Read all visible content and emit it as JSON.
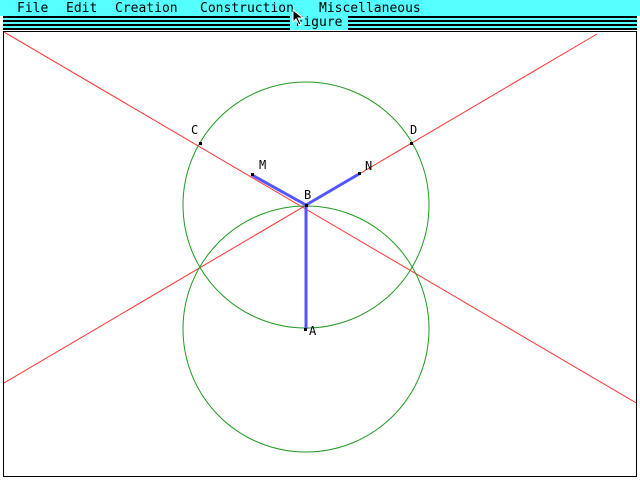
{
  "menubar": {
    "items": [
      {
        "label": "File"
      },
      {
        "label": "Edit"
      },
      {
        "label": "Creation"
      },
      {
        "label": "Construction"
      },
      {
        "label": "Miscellaneous"
      }
    ]
  },
  "window": {
    "title": "Figure"
  },
  "figure": {
    "points": {
      "A": "A",
      "B": "B",
      "C": "C",
      "D": "D",
      "M": "M",
      "N": "N"
    }
  },
  "colors": {
    "menubar": "#55ffff",
    "line": "#ff3333",
    "circle": "#229922",
    "segment": "#5555ff"
  },
  "icons": {
    "cursor": "arrow-pointer-icon"
  }
}
